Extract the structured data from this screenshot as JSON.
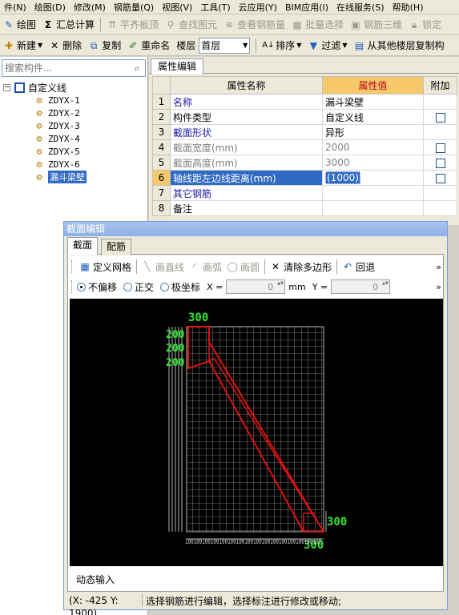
{
  "menu": [
    "件(N)",
    "绘图(D)",
    "修改(M)",
    "钢筋量(Q)",
    "视图(V)",
    "工具(T)",
    "云应用(Y)",
    "BIM应用(I)",
    "在线服务(S)",
    "帮助(H)"
  ],
  "toolbar1": {
    "draw": "绘图",
    "sum": "汇总计算",
    "align_slab": "平齐板顶",
    "find_elem": "查找图元",
    "view_rebar": "查看钢筋量",
    "batch_select": "批量选择",
    "rebar_3d": "钢筋三维",
    "lock": "锁定"
  },
  "toolbar2": {
    "new": "新建",
    "delete": "删除",
    "copy": "复制",
    "rename": "重命名",
    "floor_label": "楼层",
    "floor_value": "首层",
    "sort": "排序",
    "filter": "过滤",
    "copy_from_floor": "从其他楼层复制构"
  },
  "search": {
    "placeholder": "搜索构件..."
  },
  "tree": {
    "root": "自定义线",
    "items": [
      "ZDYX-1",
      "ZDYX-2",
      "ZDYX-3",
      "ZDYX-4",
      "ZDYX-5",
      "ZDYX-6",
      "漏斗梁壁"
    ]
  },
  "props": {
    "tab": "属性编辑",
    "col_name": "属性名称",
    "col_value": "属性值",
    "col_extra": "附加",
    "rows": [
      {
        "idx": "1",
        "name": "名称",
        "value": "漏斗梁壁"
      },
      {
        "idx": "2",
        "name": "构件类型",
        "value": "自定义线"
      },
      {
        "idx": "3",
        "name": "截面形状",
        "value": "异形"
      },
      {
        "idx": "4",
        "name": "截面宽度(mm)",
        "value": "2000"
      },
      {
        "idx": "5",
        "name": "截面高度(mm)",
        "value": "3000"
      },
      {
        "idx": "6",
        "name": "轴线距左边线距离(mm)",
        "value": "(1000)"
      },
      {
        "idx": "7",
        "name": "其它钢筋",
        "value": ""
      },
      {
        "idx": "8",
        "name": "备注",
        "value": ""
      }
    ]
  },
  "dialog": {
    "title": "截面编辑",
    "tab_section": "截面",
    "tab_rebar": "配筋",
    "define_grid": "定义网格",
    "draw_line": "画直线",
    "draw_arc": "画弧",
    "draw_circle": "画圆",
    "clear_polygon": "清除多边形",
    "undo": "回退",
    "no_offset": "不偏移",
    "ortho": "正交",
    "polar": "极坐标",
    "x_label": "X =",
    "x_value": "0",
    "unit": "mm",
    "y_label": "Y =",
    "y_value": "0",
    "dim_top": "300",
    "dim_left": [
      "200",
      "200",
      "200"
    ],
    "dim_right": "300",
    "dim_bottom": "300",
    "dim_bottom_row": "100100100100100100100100100100100100100100100100",
    "dynamic_input": "动态输入",
    "status_coord": "(X: -425 Y: 1900)",
    "status_msg": "选择钢筋进行编辑，选择标注进行修改或移动;"
  },
  "colors": {
    "selection": "#316ac5",
    "value_header": "#f7c96a",
    "dim_green": "#33e633",
    "outline_red": "#e01010"
  }
}
